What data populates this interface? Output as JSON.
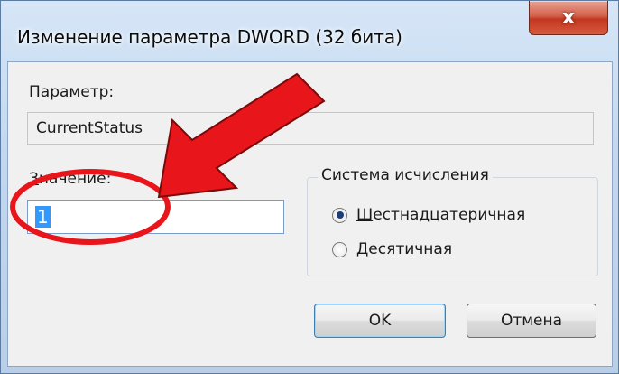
{
  "window": {
    "title": "Изменение параметра DWORD (32 бита)",
    "close_glyph": "x",
    "close_icon": "close-icon"
  },
  "name_field": {
    "label": "Параметр:",
    "label_mnemonic": "П",
    "label_rest": "араметр:",
    "value": "CurrentStatus"
  },
  "value_field": {
    "label_mnemonic": "З",
    "label_rest": "начение:",
    "value": "1"
  },
  "base_group": {
    "title": "Система исчисления",
    "options": [
      {
        "mnemonic": "Ш",
        "rest": "естнадцатеричная",
        "selected": true
      },
      {
        "mnemonic": "Д",
        "rest": "есятичная",
        "selected": false
      }
    ]
  },
  "buttons": {
    "ok": "OK",
    "cancel": "Отмена"
  },
  "annotation": {
    "arrow_color": "#e8151b",
    "circle_color": "#e8151b"
  }
}
